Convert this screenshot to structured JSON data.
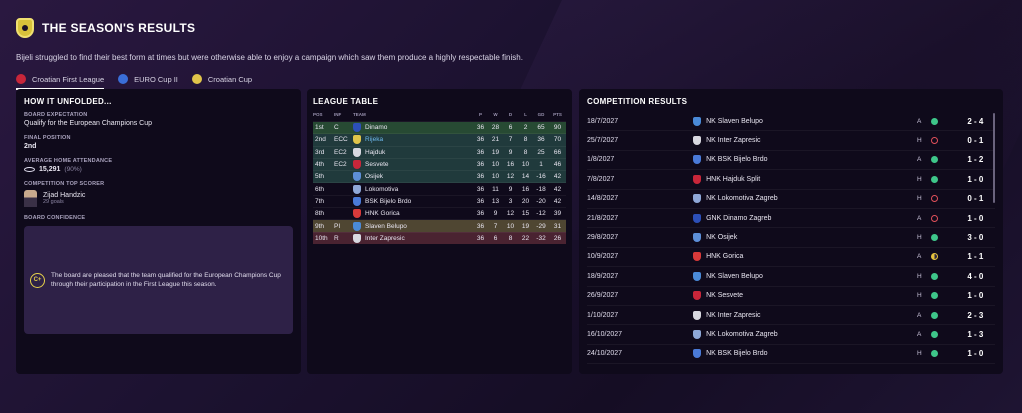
{
  "header": {
    "title": "THE SEASON'S RESULTS",
    "subtitle": "Bijeli struggled to find their best form at times but were otherwise able to enjoy a campaign which saw them produce a highly respectable finish.",
    "tabs": [
      {
        "label": "Croatian First League",
        "active": true,
        "icon_color": "#c8263a"
      },
      {
        "label": "EURO Cup II",
        "active": false,
        "icon_color": "#3a6ed8"
      },
      {
        "label": "Croatian Cup",
        "active": false,
        "icon_color": "#e0c44a"
      }
    ]
  },
  "left": {
    "title": "HOW IT UNFOLDED...",
    "board_expectation_label": "BOARD EXPECTATION",
    "board_expectation_value": "Qualify for the European Champions Cup",
    "final_position_label": "FINAL POSITION",
    "final_position_value": "2nd",
    "attendance_label": "AVERAGE HOME ATTENDANCE",
    "attendance_value": "15,291",
    "attendance_pct": "(90%)",
    "top_scorer_label": "COMPETITION TOP SCORER",
    "top_scorer_name": "Zijad Handzic",
    "top_scorer_goals": "29 goals",
    "board_confidence_label": "BOARD CONFIDENCE",
    "confidence_grade": "C+",
    "confidence_text": "The board are pleased that the team qualified for the European Champions Cup through their participation in the First League this season."
  },
  "league": {
    "title": "LEAGUE TABLE",
    "headers": [
      "POS",
      "INF",
      "TEAM",
      "P",
      "W",
      "D",
      "L",
      "GD",
      "PTS"
    ],
    "rows": [
      {
        "pos": "1st",
        "inf": "C",
        "team": "Dinamo",
        "p": "36",
        "w": "28",
        "d": "6",
        "l": "2",
        "gd": "65",
        "pts": "90",
        "style": "r-green",
        "crest": "#2c4fb8",
        "hl": false
      },
      {
        "pos": "2nd",
        "inf": "ECC",
        "team": "Rijeka",
        "p": "36",
        "w": "21",
        "d": "7",
        "l": "8",
        "gd": "36",
        "pts": "70",
        "style": "r-teal",
        "crest": "#e0c44a",
        "hl": true
      },
      {
        "pos": "3rd",
        "inf": "EC2",
        "team": "Hajduk",
        "p": "36",
        "w": "19",
        "d": "9",
        "l": "8",
        "gd": "25",
        "pts": "66",
        "style": "r-teal",
        "crest": "#d8d8e0",
        "hl": false
      },
      {
        "pos": "4th",
        "inf": "EC2",
        "team": "Sesvete",
        "p": "36",
        "w": "10",
        "d": "16",
        "l": "10",
        "gd": "1",
        "pts": "46",
        "style": "r-teal",
        "crest": "#c8263a",
        "hl": false
      },
      {
        "pos": "5th",
        "inf": "",
        "team": "Osijek",
        "p": "36",
        "w": "10",
        "d": "12",
        "l": "14",
        "gd": "-16",
        "pts": "42",
        "style": "r-teal",
        "crest": "#5d8fd8",
        "hl": false
      },
      {
        "pos": "6th",
        "inf": "",
        "team": "Lokomotiva",
        "p": "36",
        "w": "11",
        "d": "9",
        "l": "16",
        "gd": "-18",
        "pts": "42",
        "style": "",
        "crest": "#8fa8d8",
        "hl": false
      },
      {
        "pos": "7th",
        "inf": "",
        "team": "BSK Bijelo Brdo",
        "p": "36",
        "w": "13",
        "d": "3",
        "l": "20",
        "gd": "-20",
        "pts": "42",
        "style": "",
        "crest": "#4a7ad8",
        "hl": false
      },
      {
        "pos": "8th",
        "inf": "",
        "team": "HNK Gorica",
        "p": "36",
        "w": "9",
        "d": "12",
        "l": "15",
        "gd": "-12",
        "pts": "39",
        "style": "",
        "crest": "#d83a3a",
        "hl": false
      },
      {
        "pos": "9th",
        "inf": "PI",
        "team": "Slaven Belupo",
        "p": "36",
        "w": "7",
        "d": "10",
        "l": "19",
        "gd": "-29",
        "pts": "31",
        "style": "r-gold",
        "crest": "#4a8ad8",
        "hl": false
      },
      {
        "pos": "10th",
        "inf": "R",
        "team": "Inter Zapresic",
        "p": "36",
        "w": "6",
        "d": "8",
        "l": "22",
        "gd": "-32",
        "pts": "26",
        "style": "r-red",
        "crest": "#d8d8e0",
        "hl": false
      }
    ]
  },
  "results": {
    "title": "COMPETITION RESULTS",
    "rows": [
      {
        "date": "18/7/2027",
        "team": "NK Slaven Belupo",
        "ha": "A",
        "res": "w",
        "score": "2 - 4",
        "crest": "#4a8ad8"
      },
      {
        "date": "25/7/2027",
        "team": "NK Inter Zapresic",
        "ha": "H",
        "res": "l",
        "score": "0 - 1",
        "crest": "#d8d8e0"
      },
      {
        "date": "1/8/2027",
        "team": "NK BSK Bijelo Brdo",
        "ha": "A",
        "res": "w",
        "score": "1 - 2",
        "crest": "#4a7ad8"
      },
      {
        "date": "7/8/2027",
        "team": "HNK Hajduk Split",
        "ha": "H",
        "res": "w",
        "score": "1 - 0",
        "crest": "#c8263a"
      },
      {
        "date": "14/8/2027",
        "team": "NK Lokomotiva Zagreb",
        "ha": "H",
        "res": "l",
        "score": "0 - 1",
        "crest": "#8fa8d8"
      },
      {
        "date": "21/8/2027",
        "team": "GNK Dinamo Zagreb",
        "ha": "A",
        "res": "l",
        "score": "1 - 0",
        "crest": "#2c4fb8"
      },
      {
        "date": "29/8/2027",
        "team": "NK Osijek",
        "ha": "H",
        "res": "w",
        "score": "3 - 0",
        "crest": "#5d8fd8"
      },
      {
        "date": "10/9/2027",
        "team": "HNK Gorica",
        "ha": "A",
        "res": "d",
        "score": "1 - 1",
        "crest": "#d83a3a"
      },
      {
        "date": "18/9/2027",
        "team": "NK Slaven Belupo",
        "ha": "H",
        "res": "w",
        "score": "4 - 0",
        "crest": "#4a8ad8"
      },
      {
        "date": "26/9/2027",
        "team": "NK Sesvete",
        "ha": "H",
        "res": "w",
        "score": "1 - 0",
        "crest": "#c8263a"
      },
      {
        "date": "1/10/2027",
        "team": "NK Inter Zapresic",
        "ha": "A",
        "res": "w",
        "score": "2 - 3",
        "crest": "#d8d8e0"
      },
      {
        "date": "16/10/2027",
        "team": "NK Lokomotiva Zagreb",
        "ha": "A",
        "res": "w",
        "score": "1 - 3",
        "crest": "#8fa8d8"
      },
      {
        "date": "24/10/2027",
        "team": "NK BSK Bijelo Brdo",
        "ha": "H",
        "res": "w",
        "score": "1 - 0",
        "crest": "#4a7ad8"
      }
    ]
  }
}
